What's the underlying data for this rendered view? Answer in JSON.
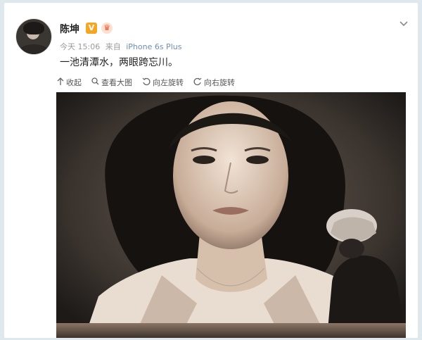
{
  "post": {
    "author": "陈坤",
    "verified_badge": "V",
    "vip_badge": "♛",
    "time": "今天 15:06",
    "source_prefix": "来自",
    "device": "iPhone 6s Plus",
    "text": "一池清潭水，两眼跨忘川。"
  },
  "toolbar": {
    "collapse_label": "收起",
    "view_large_label": "查看大图",
    "rotate_left_label": "向左旋转",
    "rotate_right_label": "向右旋转"
  },
  "icons": {
    "collapse": "arrow-up-icon",
    "view_large": "magnifier-icon",
    "rotate_left": "rotate-left-icon",
    "rotate_right": "rotate-right-icon",
    "menu": "chevron-down-icon"
  },
  "colors": {
    "device_link": "#6d8fb4",
    "verified": "#f5a623",
    "background": "#dfe8ec"
  }
}
